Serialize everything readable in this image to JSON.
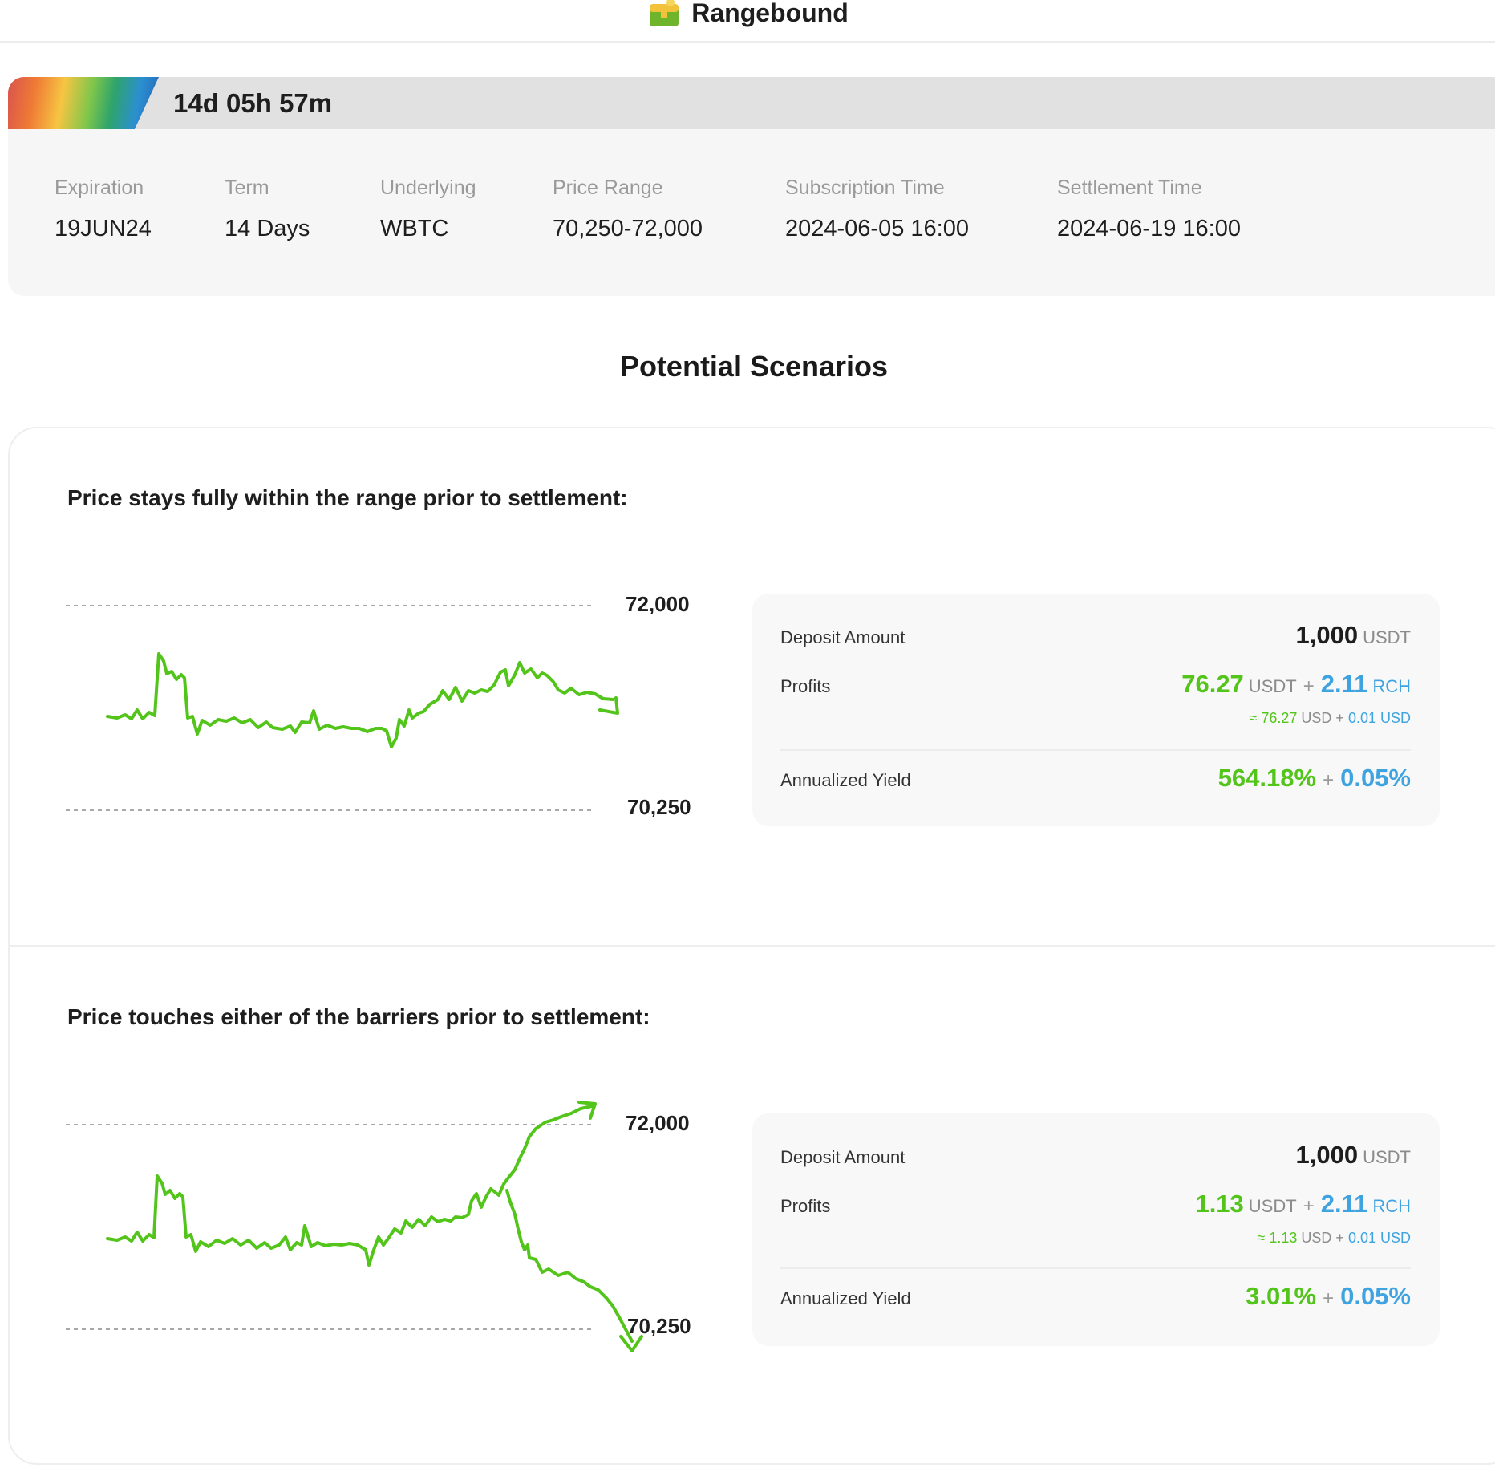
{
  "header": {
    "title": "Rangebound",
    "logo_icon": "treasure-chest-icon"
  },
  "countdown": "14d 05h 57m",
  "info": [
    {
      "label": "Expiration",
      "value": "19JUN24"
    },
    {
      "label": "Term",
      "value": "14 Days"
    },
    {
      "label": "Underlying",
      "value": "WBTC"
    },
    {
      "label": "Price Range",
      "value": "70,250-72,000"
    },
    {
      "label": "Subscription Time",
      "value": "2024-06-05 16:00"
    },
    {
      "label": "Settlement Time",
      "value": "2024-06-19 16:00"
    }
  ],
  "section_title": "Potential Scenarios",
  "colors": {
    "green": "#52c41a",
    "blue": "#3fa3e0",
    "card_bg": "#f6f6f6"
  },
  "scenarios": [
    {
      "title": "Price stays fully within the range prior to settlement:",
      "upper_label": "72,000",
      "lower_label": "70,250",
      "deposit_label": "Deposit Amount",
      "deposit_value": "1,000",
      "deposit_unit": "USDT",
      "profits_label": "Profits",
      "profit_main": "76.27",
      "profit_main_unit": "USDT",
      "profit_plus": "+",
      "profit_bonus": "2.11",
      "profit_bonus_unit": "RCH",
      "approx_symbol": "≈",
      "approx_main": "76.27",
      "approx_main_unit": "USD",
      "approx_bonus": "0.01 USD",
      "yield_label": "Annualized Yield",
      "yield_main": "564.18%",
      "yield_bonus": "0.05%"
    },
    {
      "title": "Price touches either of the barriers prior to settlement:",
      "upper_label": "72,000",
      "lower_label": "70,250",
      "deposit_label": "Deposit Amount",
      "deposit_value": "1,000",
      "deposit_unit": "USDT",
      "profits_label": "Profits",
      "profit_main": "1.13",
      "profit_main_unit": "USDT",
      "profit_plus": "+",
      "profit_bonus": "2.11",
      "profit_bonus_unit": "RCH",
      "approx_symbol": "≈",
      "approx_main": "1.13",
      "approx_main_unit": "USD",
      "approx_bonus": "0.01 USD",
      "yield_label": "Annualized Yield",
      "yield_main": "3.01%",
      "yield_bonus": "0.05%"
    }
  ]
}
